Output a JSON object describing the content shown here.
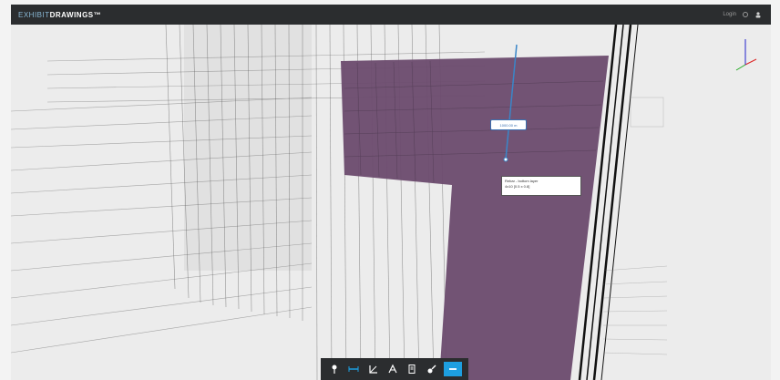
{
  "app": {
    "brand_part1": "EXHIBIT",
    "brand_part2": "DRAWINGS",
    "trademark": "™",
    "login_text": "Login"
  },
  "viewport": {
    "dimension_label": "1000.00 m",
    "info_line1": "Rebar - bottom layer",
    "info_line2": "4x10 [0.5 x 0.8]"
  },
  "toolbar": {
    "items": [
      {
        "name": "pin-tool",
        "icon": "pin-icon",
        "active": false
      },
      {
        "name": "measure-line-tool",
        "icon": "ruler-icon",
        "active": false
      },
      {
        "name": "angle-tool",
        "icon": "angle-icon",
        "active": false
      },
      {
        "name": "text-tool",
        "icon": "text-icon",
        "active": false
      },
      {
        "name": "document-tool",
        "icon": "document-icon",
        "active": false
      },
      {
        "name": "paint-tool",
        "icon": "paint-icon",
        "active": false
      },
      {
        "name": "active-tool",
        "icon": "mode-icon",
        "active": true
      }
    ]
  },
  "colors": {
    "topbar_bg": "#2b2d2f",
    "accent": "#1d9fe0",
    "wall_purple": "#6b4b6e"
  }
}
